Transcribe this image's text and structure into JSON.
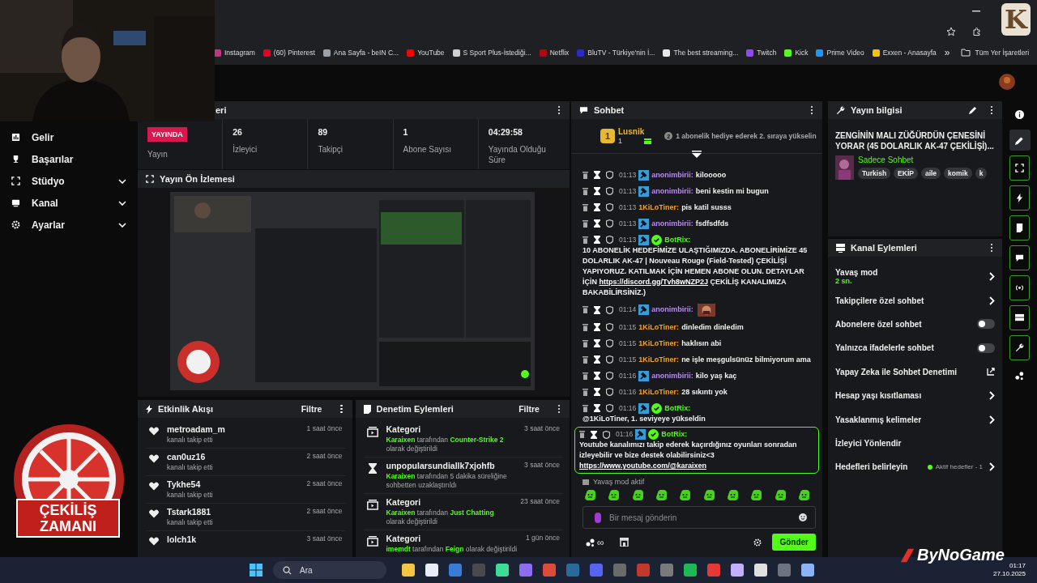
{
  "browser": {
    "bookmarks": [
      {
        "label": "Instagram",
        "color": "#c13584"
      },
      {
        "label": "(60) Pinterest",
        "color": "#e60023"
      },
      {
        "label": "Ana Sayfa - beIN C...",
        "color": "#9aa0a6"
      },
      {
        "label": "YouTube",
        "color": "#ff0000"
      },
      {
        "label": "S Sport Plus-İstediği...",
        "color": "#d0d0d0"
      },
      {
        "label": "Netflix",
        "color": "#b20710"
      },
      {
        "label": "BluTV - Türkiye'nin İ...",
        "color": "#2a2ad0"
      },
      {
        "label": "The best streaming...",
        "color": "#e8e8e8"
      },
      {
        "label": "Twitch",
        "color": "#9146ff"
      },
      {
        "label": "Kick",
        "color": "#53fc18"
      },
      {
        "label": "Prime Video",
        "color": "#1a98ff"
      },
      {
        "label": "Exxen - Anasayfa",
        "color": "#f5c400"
      }
    ],
    "more": "»",
    "all_bookmarks": "Tüm Yer İşaretleri"
  },
  "sidebar": {
    "items": [
      {
        "label": "Gelir",
        "has_submenu": false
      },
      {
        "label": "Başarılar",
        "has_submenu": false
      },
      {
        "label": "Stüdyo",
        "has_submenu": true
      },
      {
        "label": "Kanal",
        "has_submenu": true
      },
      {
        "label": "Ayarlar",
        "has_submenu": true
      }
    ]
  },
  "stats": {
    "title": "eri",
    "cells": [
      {
        "kind": "badge",
        "value": "YAYINDA",
        "label": "Yayın"
      },
      {
        "kind": "number",
        "value": "26",
        "label": "İzleyici"
      },
      {
        "kind": "number",
        "value": "89",
        "label": "Takipçi"
      },
      {
        "kind": "number",
        "value": "1",
        "label": "Abone Sayısı"
      },
      {
        "kind": "number",
        "value": "04:29:58",
        "label": "Yayında Olduğu Süre"
      }
    ]
  },
  "preview": {
    "title": "Yayın Ön İzlemesi"
  },
  "activity": {
    "title": "Etkinlik Akışı",
    "filter": "Filtre",
    "items": [
      {
        "user": "metroadam_m",
        "action": "kanalı takip etti",
        "time": "1 saat önce"
      },
      {
        "user": "can0uz16",
        "action": "kanalı takip etti",
        "time": "2 saat önce"
      },
      {
        "user": "Tykhe54",
        "action": "kanalı takip etti",
        "time": "2 saat önce"
      },
      {
        "user": "Tstark1881",
        "action": "kanalı takip etti",
        "time": "2 saat önce"
      },
      {
        "user": "lolch1k",
        "time": "3 saat önce"
      }
    ]
  },
  "moderation": {
    "title": "Denetim Eylemleri",
    "filter": "Filtre",
    "items": [
      {
        "kind": "category",
        "title": "Kategori",
        "time": "3 saat önce",
        "parts": [
          {
            "text": "Karaixen",
            "highlight": true
          },
          {
            "text": " tarafından ",
            "highlight": false
          },
          {
            "text": "Counter-Strike 2",
            "highlight": true
          },
          {
            "text": " olarak değiştirildi",
            "highlight": false
          }
        ]
      },
      {
        "kind": "timeout",
        "title": "unpopularsundiallk7xjohfb",
        "time": "3 saat önce",
        "parts": [
          {
            "text": "Karaixen",
            "highlight": true
          },
          {
            "text": " tarafından 5 dakika süreliğine sohbetten uzaklaştırıldı",
            "highlight": false
          }
        ]
      },
      {
        "kind": "category",
        "title": "Kategori",
        "time": "23 saat önce",
        "parts": [
          {
            "text": "Karaixen",
            "highlight": true
          },
          {
            "text": " tarafından ",
            "highlight": false
          },
          {
            "text": "Just Chatting",
            "highlight": true
          },
          {
            "text": " olarak değiştirildi",
            "highlight": false
          }
        ]
      },
      {
        "kind": "category",
        "title": "Kategori",
        "time": "1 gün önce",
        "parts": [
          {
            "text": "imemdt",
            "highlight": true
          },
          {
            "text": " tarafından ",
            "highlight": false
          },
          {
            "text": "Feign",
            "highlight": true
          },
          {
            "text": " olarak değiştirildi",
            "highlight": false
          }
        ]
      }
    ]
  },
  "chat": {
    "title": "Sohbet",
    "leader": {
      "rank": "1",
      "name": "Lusnik",
      "count": "1",
      "next_rank": "2",
      "hint": "1 abonelik hediye ederek 2. sıraya yükselin"
    },
    "messages": [
      {
        "time": "01:13",
        "user": "anonimbirii:",
        "color": "#b88cf7",
        "moderator": true,
        "verified": false,
        "text": "kilooooo",
        "highlighted": false
      },
      {
        "time": "01:13",
        "user": "anonimbirii:",
        "color": "#b88cf7",
        "moderator": true,
        "verified": false,
        "text": "beni kestin mi bugun",
        "highlighted": false
      },
      {
        "time": "01:13",
        "user": "1KiLoTiner:",
        "color": "#f5a524",
        "moderator": false,
        "verified": false,
        "text": "pis katil susss",
        "highlighted": false
      },
      {
        "time": "01:13",
        "user": "anonimbirii:",
        "color": "#b88cf7",
        "moderator": true,
        "verified": false,
        "text": "fsdfsdfds",
        "highlighted": false
      },
      {
        "time": "01:13",
        "user": "BotRix:",
        "color": "#53fc18",
        "moderator": true,
        "verified": true,
        "text": "10 ABONELİK HEDEFİMİZE ULAŞTIĞIMIZDA. ABONELİRİMİZE 45 DOLARLIK AK-47 | Nouveau Rouge (Field-Tested) ÇEKİLİŞİ YAPIYORUZ. KATILMAK İÇİN HEMEN ABONE OLUN. DETAYLAR İÇİN",
        "link": "https://discord.gg/Tvh8wNZP2J",
        "text_after": "ÇEKİLİŞ KANALIMIZA BAKABİLİRSİNİZ.)",
        "highlighted": false
      },
      {
        "time": "01:14",
        "user": "anonimbirii:",
        "color": "#b88cf7",
        "moderator": true,
        "verified": false,
        "emote": true,
        "highlighted": false
      },
      {
        "time": "01:15",
        "user": "1KiLoTiner:",
        "color": "#f5a524",
        "moderator": false,
        "verified": false,
        "text": "dinledim dinledim",
        "highlighted": false
      },
      {
        "time": "01:15",
        "user": "1KiLoTiner:",
        "color": "#f5a524",
        "moderator": false,
        "verified": false,
        "text": "haklısın abi",
        "highlighted": false
      },
      {
        "time": "01:15",
        "user": "1KiLoTiner:",
        "color": "#f5a524",
        "moderator": false,
        "verified": false,
        "text": "ne işle meşgulsünüz bilmiyorum ama",
        "highlighted": false
      },
      {
        "time": "01:16",
        "user": "anonimbirii:",
        "color": "#b88cf7",
        "moderator": true,
        "verified": false,
        "text": "kilo yaş kaç",
        "highlighted": false
      },
      {
        "time": "01:16",
        "user": "1KiLoTiner:",
        "color": "#f5a524",
        "moderator": false,
        "verified": false,
        "text": "28 sıkıntı yok",
        "highlighted": false
      },
      {
        "time": "01:16",
        "user": "BotRix:",
        "color": "#53fc18",
        "moderator": true,
        "verified": true,
        "text": "@1KiLoTiner, 1. seviyeye yükseldin",
        "highlighted": false
      },
      {
        "time": "01:16",
        "user": "BotRix:",
        "color": "#53fc18",
        "moderator": true,
        "verified": true,
        "text": "Youtube kanalımızı takip ederek kaçırdığınız oyunları sonradan izleyebilir ve bize destek olabilirsiniz<3",
        "link": "https://www.youtube.com/@karaixen",
        "highlighted": true
      }
    ],
    "slow_mode": "Yavaş mod aktif",
    "placeholder": "Bir mesaj gönderin",
    "points": "∞",
    "send": "Gönder"
  },
  "stream_info": {
    "title": "Yayın bilgisi",
    "stream_title": "ZENGİNİN MALI ZÜĞÜRDÜN ÇENESİNİ YORAR (45 DOLARLIK AK-47 ÇEKİLİŞİ)...",
    "category": "Sadece Sohbet",
    "tags": [
      "Turkish",
      "EKİP",
      "aile",
      "komik",
      "k"
    ]
  },
  "channel_actions": {
    "title": "Kanal Eylemleri",
    "items": [
      {
        "kind": "link",
        "label": "Yavaş mod",
        "sub": "2 sn."
      },
      {
        "kind": "link",
        "label": "Takipçilere özel sohbet"
      },
      {
        "kind": "toggle",
        "label": "Abonelere özel sohbet",
        "on": false
      },
      {
        "kind": "toggle",
        "label": "Yalnızca ifadelerle sohbet",
        "on": false
      },
      {
        "kind": "external",
        "label": "Yapay Zeka ile Sohbet Denetimi"
      },
      {
        "kind": "link",
        "label": "Hesap yaşı kısıtlaması"
      },
      {
        "kind": "link",
        "label": "Yasaklanmış kelimeler"
      },
      {
        "kind": "plain",
        "label": "İzleyici Yönlendir"
      },
      {
        "kind": "goal",
        "label": "Hedefleri belirleyin",
        "status": "Aktif hedefler - 1"
      }
    ]
  },
  "rail": {
    "items": [
      {
        "selected": false,
        "pinned": false
      },
      {
        "selected": true,
        "pinned": false
      },
      {
        "selected": false,
        "pinned": true
      },
      {
        "selected": false,
        "pinned": true
      },
      {
        "selected": false,
        "pinned": true
      },
      {
        "selected": false,
        "pinned": true
      },
      {
        "selected": false,
        "pinned": true
      },
      {
        "selected": false,
        "pinned": true
      },
      {
        "selected": false,
        "pinned": true
      },
      {
        "selected": false,
        "pinned": false
      }
    ]
  },
  "taskbar": {
    "search": "Ara",
    "time": "01:17",
    "date": "27.10.2025",
    "apps": [
      {
        "color": "#f4c542"
      },
      {
        "color": "#e8eef8"
      },
      {
        "color": "#3a7bd5"
      },
      {
        "color": "#4a4a4a"
      },
      {
        "color": "#3ddc97"
      },
      {
        "color": "#8c6cf0"
      },
      {
        "color": "#dd4b39"
      },
      {
        "color": "#2a6a9a"
      },
      {
        "color": "#5865f2"
      },
      {
        "color": "#6a6a6a"
      },
      {
        "color": "#c0392b"
      },
      {
        "color": "#7a7a7a"
      },
      {
        "color": "#1db954"
      },
      {
        "color": "#e53935"
      },
      {
        "color": "#c0b0ff"
      },
      {
        "color": "#e0e0e0"
      },
      {
        "color": "#6b7280"
      },
      {
        "color": "#8ab4f8"
      }
    ]
  },
  "overlays": {
    "corner_logo": "K",
    "giveaway": "ÇEKİLİŞ ZAMANI",
    "brand": "ByNoGame"
  }
}
